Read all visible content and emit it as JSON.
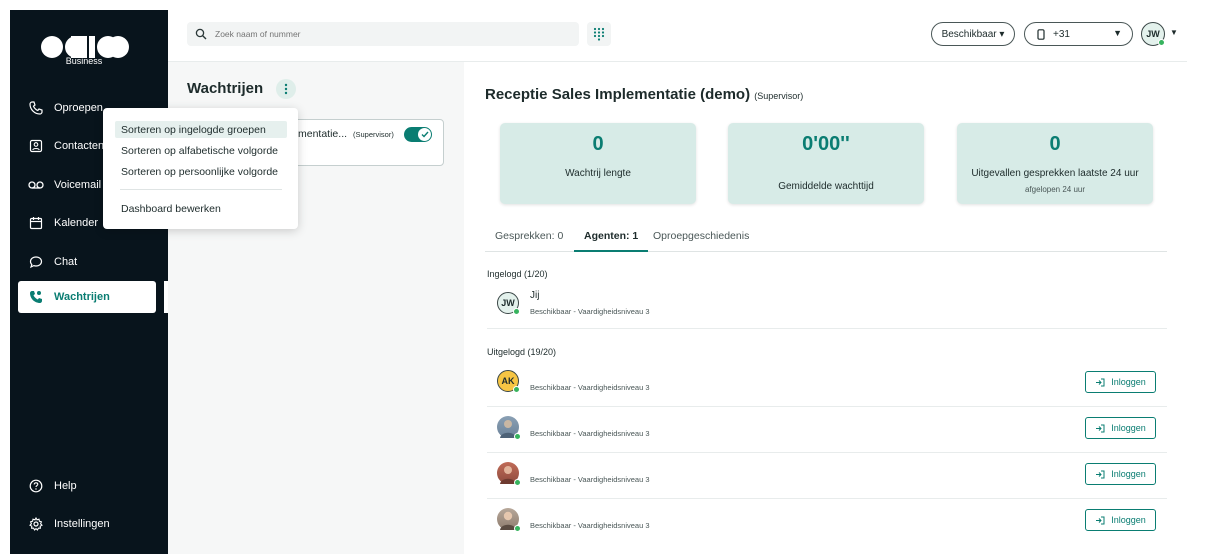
{
  "brand": {
    "logo_subtitle": "Business",
    "accent": "#0a7d72",
    "sidebar_bg": "#08141c"
  },
  "sidebar": {
    "items": [
      {
        "label": "Oproepen",
        "icon": "phone-icon"
      },
      {
        "label": "Contacten",
        "icon": "contact-card-icon"
      },
      {
        "label": "Voicemail",
        "icon": "voicemail-icon"
      },
      {
        "label": "Kalender",
        "icon": "calendar-icon"
      },
      {
        "label": "Chat",
        "icon": "chat-icon"
      },
      {
        "label": "Wachtrijen",
        "icon": "queue-phone-icon",
        "active": true
      }
    ],
    "bottom": [
      {
        "label": "Help",
        "icon": "help-icon"
      },
      {
        "label": "Instellingen",
        "icon": "gear-icon"
      }
    ]
  },
  "topbar": {
    "search_placeholder": "Zoek naam of nummer",
    "status_label": "Beschikbaar ▾",
    "phone_label": "+31",
    "user_initials": "JW"
  },
  "queues": {
    "title": "Wachtrijen",
    "card": {
      "name": "mentatie...",
      "role": "(Supervisor)",
      "enabled": true
    }
  },
  "sort_menu": {
    "items": [
      "Sorteren op ingelogde groepen",
      "Sorteren op alfabetische volgorde",
      "Sorteren op persoonlijke volgorde"
    ],
    "selected_index": 0,
    "extra": "Dashboard bewerken"
  },
  "main": {
    "title": "Receptie Sales Implementatie (demo)",
    "title_role": "(Supervisor)",
    "stats": [
      {
        "value": "0",
        "label": "Wachtrij lengte",
        "sub": ""
      },
      {
        "value": "0'00''",
        "label": "Gemiddelde wachttijd",
        "sub": ""
      },
      {
        "value": "0",
        "label": "Uitgevallen gesprekken laatste 24 uur",
        "sub": "afgelopen 24 uur"
      }
    ],
    "tabs": [
      "Gesprekken: 0",
      "Agenten: 1",
      "Oproepgeschiedenis"
    ],
    "logged_in_label": "Ingelogd (1/20)",
    "logged_out_label": "Uitgelogd (19/20)",
    "logged_in": [
      {
        "initials": "JW",
        "name": "Jij",
        "status": "Beschikbaar - Vaardigheidsniveau 3"
      }
    ],
    "logged_out": [
      {
        "initials": "AK",
        "status": "Beschikbaar - Vaardigheidsniveau 3",
        "button": "Inloggen"
      },
      {
        "initials": "",
        "status": "Beschikbaar - Vaardigheidsniveau 3",
        "button": "Inloggen"
      },
      {
        "initials": "",
        "status": "Beschikbaar - Vaardigheidsniveau 3",
        "button": "Inloggen"
      },
      {
        "initials": "",
        "status": "Beschikbaar - Vaardigheidsniveau 3",
        "button": "Inloggen"
      }
    ]
  }
}
